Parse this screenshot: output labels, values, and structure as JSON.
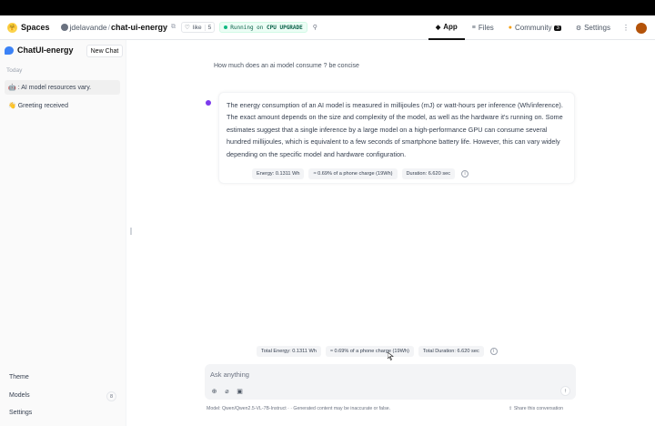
{
  "header": {
    "spaces_label": "Spaces",
    "owner": "jdelavande",
    "repo": "chat-ui-energy",
    "like_label": "like",
    "like_count": "5",
    "running_label": "Running on",
    "hardware": "CPU UPGRADE",
    "tabs": [
      {
        "label": "App",
        "icon": "app-icon"
      },
      {
        "label": "Files",
        "icon": "files-icon"
      },
      {
        "label": "Community",
        "icon": "community-icon",
        "badge": "3"
      },
      {
        "label": "Settings",
        "icon": "gear-icon"
      }
    ]
  },
  "sidebar": {
    "brand": "ChatUI-energy",
    "new_chat": "New Chat",
    "section": "Today",
    "conversations": [
      {
        "emoji": "🤖",
        "label": ": AI model resources vary."
      },
      {
        "emoji": "👋",
        "label": "Greeting received"
      }
    ],
    "footer": {
      "theme": "Theme",
      "models": "Models",
      "models_count": "8",
      "settings": "Settings"
    }
  },
  "chat": {
    "user_message": "How much does an ai model consume ? be concise",
    "bot_message": "The energy consumption of an AI model is measured in millijoules (mJ) or watt-hours per inference (Wh/inference). The exact amount depends on the size and complexity of the model, as well as the hardware it's running on. Some estimates suggest that a single inference by a large model on a high-performance GPU can consume several hundred millijoules, which is equivalent to a few seconds of smartphone battery life. However, this can vary widely depending on the specific model and hardware configuration.",
    "message_stats": {
      "energy": "Energy: 0.1311 Wh",
      "phone": "≈ 0.69% of a phone charge (19Wh)",
      "duration": "Duration: 6.620 sec"
    },
    "total_stats": {
      "energy": "Total Energy: 0.1311 Wh",
      "phone": "≈ 0.69% of a phone charge (19Wh)",
      "duration": "Total Duration: 6.620 sec"
    }
  },
  "input": {
    "placeholder": "Ask anything"
  },
  "footer": {
    "model_note": "Model: Qwen/Qwen2.5-VL-7B-Instruct · · Generated content may be inaccurate or false.",
    "share": "Share this conversation"
  },
  "colors": {
    "brand_blue": "#3b82f6",
    "bot_dot": "#7c3aed",
    "running_green": "#10b981"
  }
}
